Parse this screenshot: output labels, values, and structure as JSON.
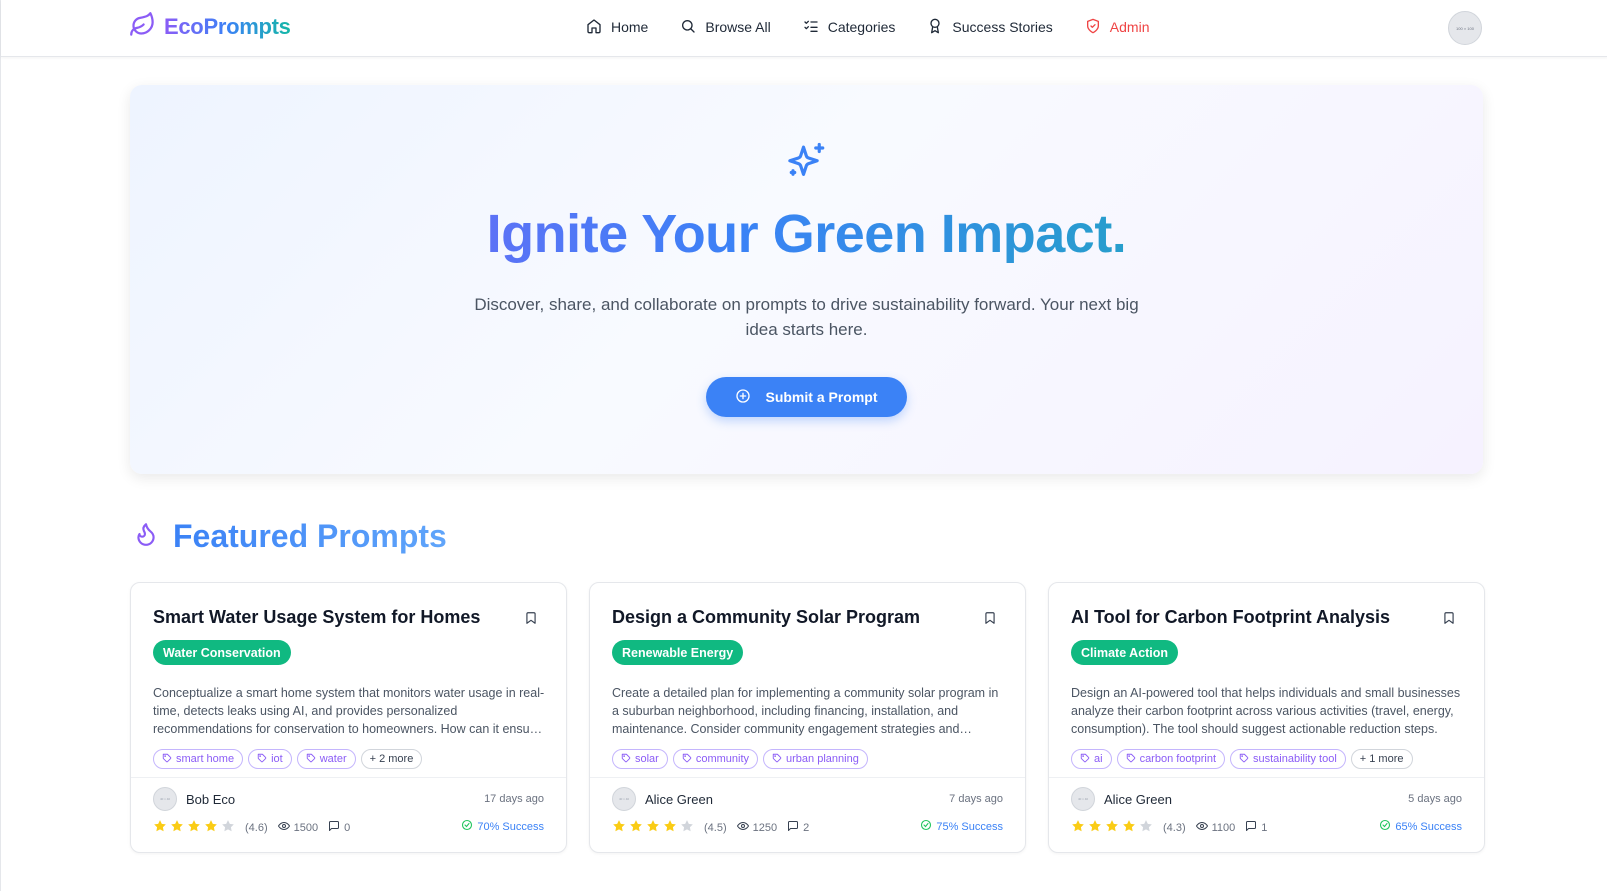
{
  "brand": {
    "name": "EcoPrompts",
    "icon": "leaf-icon"
  },
  "nav": {
    "items": [
      {
        "label": "Home",
        "icon": "home-icon"
      },
      {
        "label": "Browse All",
        "icon": "search-icon"
      },
      {
        "label": "Categories",
        "icon": "list-check-icon"
      },
      {
        "label": "Success Stories",
        "icon": "award-icon"
      },
      {
        "label": "Admin",
        "icon": "shield-icon"
      }
    ],
    "avatar_alt": "100 × 100"
  },
  "hero": {
    "icon": "sparkles-icon",
    "title": "Ignite Your Green Impact.",
    "subtitle": "Discover, share, and collaborate on prompts to drive sustainability forward. Your next big idea starts here.",
    "button_label": "Submit a Prompt"
  },
  "featured": {
    "icon": "flame-icon",
    "title": "Featured Prompts",
    "cards": [
      {
        "title": "Smart Water Usage System for Homes",
        "category": "Water Conservation",
        "description": "Conceptualize a smart home system that monitors water usage in real-time, detects leaks using AI, and provides personalized recommendations for conservation to homeowners. How can it ensure privacy and user engagement?",
        "tags": [
          "smart home",
          "iot",
          "water"
        ],
        "more": "+ 2 more",
        "author": "Bob Eco",
        "avatar_alt": "40 × 40",
        "time": "17 days ago",
        "rating_value": 4.6,
        "rating": "(4.6)",
        "views": "1500",
        "comments": "0",
        "success": "70% Success"
      },
      {
        "title": "Design a Community Solar Program",
        "category": "Renewable Energy",
        "description": "Create a detailed plan for implementing a community solar program in a suburban neighborhood, including financing, installation, and maintenance. Consider community engagement strategies and regulatory hurdles.",
        "tags": [
          "solar",
          "community",
          "urban planning"
        ],
        "more": "",
        "author": "Alice Green",
        "avatar_alt": "40 × 40",
        "time": "7 days ago",
        "rating_value": 4.5,
        "rating": "(4.5)",
        "views": "1250",
        "comments": "2",
        "success": "75% Success"
      },
      {
        "title": "AI Tool for Carbon Footprint Analysis",
        "category": "Climate Action",
        "description": "Design an AI-powered tool that helps individuals and small businesses analyze their carbon footprint across various activities (travel, energy, consumption). The tool should suggest actionable reduction steps.",
        "tags": [
          "ai",
          "carbon footprint",
          "sustainability tool"
        ],
        "more": "+ 1 more",
        "author": "Alice Green",
        "avatar_alt": "40 × 40",
        "time": "5 days ago",
        "rating_value": 4.3,
        "rating": "(4.3)",
        "views": "1100",
        "comments": "1",
        "success": "65% Success"
      }
    ]
  },
  "colors": {
    "primary": "#3b82f6",
    "purple": "#8b5cf6",
    "teal": "#14b8a6",
    "badge_green": "#10b981",
    "admin_red": "#ef4444",
    "star": "#facc15",
    "success_check": "#22c55e"
  }
}
